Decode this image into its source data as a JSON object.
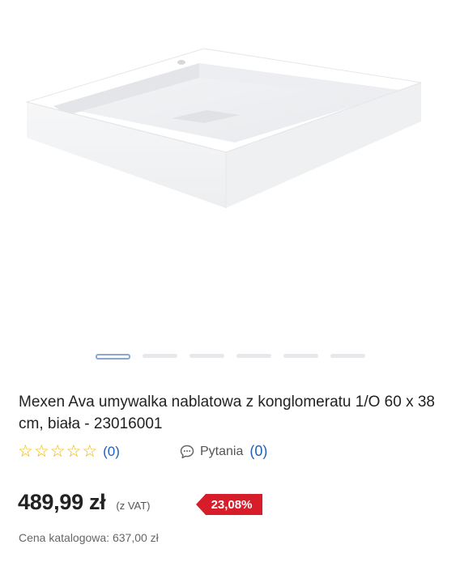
{
  "gallery": {
    "image_alt": "Mexen Ava washbasin product photo",
    "slide_count": 6,
    "active_slide": 1
  },
  "product": {
    "title": "Mexen Ava umywalka nablatowa z konglomeratu 1/O 60 x 38 cm, biała - 23016001",
    "rating_count": "(0)",
    "questions_label": "Pytania",
    "questions_count": "(0)",
    "price": "489,99 zł",
    "vat_note": "(z VAT)",
    "discount": "23,08%",
    "catalog_price": "Cena katalogowa: 637,00 zł"
  },
  "colors": {
    "star": "#f0b400",
    "link": "#1f5fbf",
    "discount_bg": "#d81d2a"
  }
}
